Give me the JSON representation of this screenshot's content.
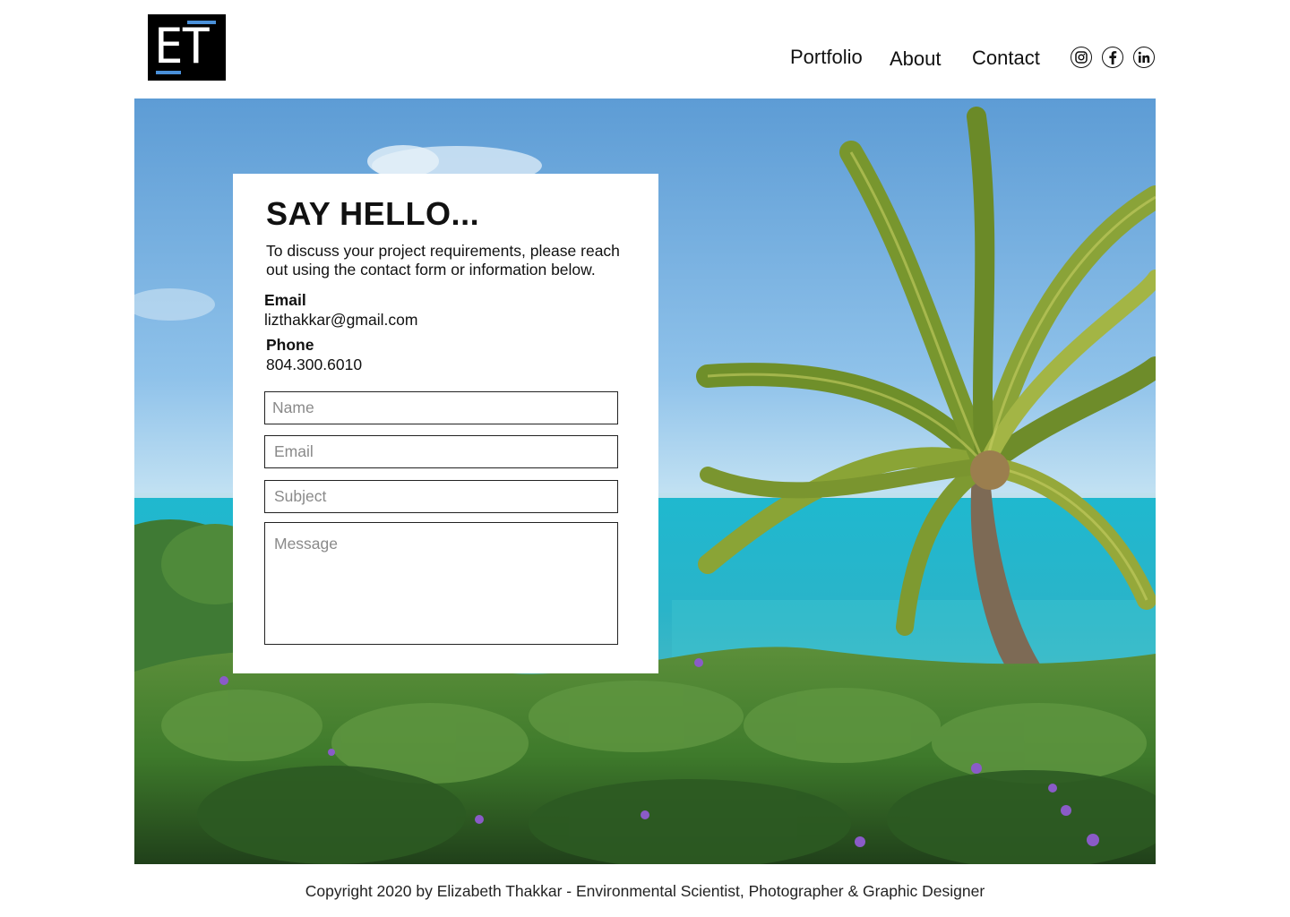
{
  "brand": {
    "logo_text": "ET",
    "colors": {
      "logo_bg": "#000000",
      "logo_text": "#ffffff",
      "logo_accent": "#4a90d9"
    }
  },
  "nav": {
    "items": [
      {
        "label": "Portfolio"
      },
      {
        "label": "About"
      },
      {
        "label": "Contact"
      }
    ]
  },
  "social": {
    "icons": [
      "instagram-icon",
      "facebook-icon",
      "linkedin-icon"
    ]
  },
  "hero": {
    "image": "tropical beach with palm tree, turquoise sea and green shrubs with purple flowers"
  },
  "contact": {
    "title": "SAY HELLO...",
    "description": "To discuss your project requirements, please reach out using the contact form or information below.",
    "email_label": "Email",
    "email_value": "lizthakkar@gmail.com",
    "phone_label": "Phone",
    "phone_value": "804.300.6010",
    "form": {
      "name_placeholder": "Name",
      "email_placeholder": "Email",
      "subject_placeholder": "Subject",
      "message_placeholder": "Message"
    }
  },
  "footer": {
    "copyright": "Copyright 2020 by Elizabeth Thakkar - Environmental Scientist, Photographer & Graphic Designer"
  }
}
